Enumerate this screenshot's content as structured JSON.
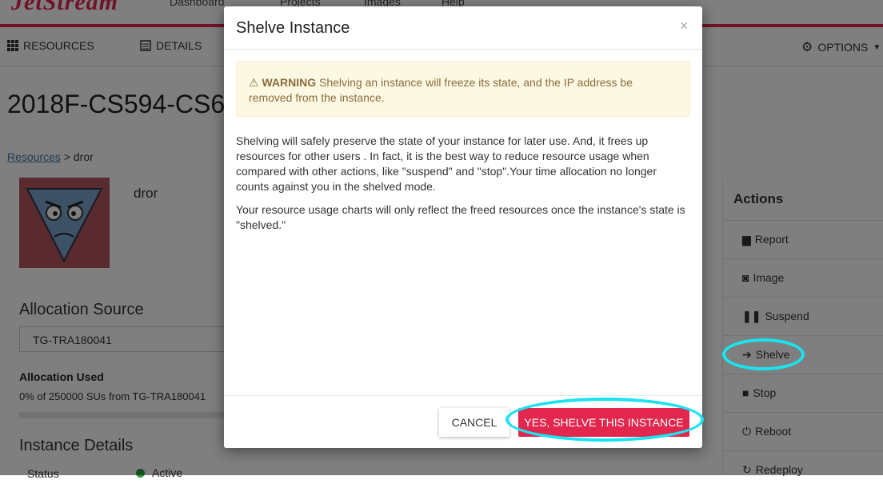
{
  "topnav": {
    "logo": "JetStream",
    "items": [
      "Dashboard",
      "Projects",
      "Images",
      "Help"
    ]
  },
  "subnav": {
    "resources_label": "RESOURCES",
    "details_label": "DETAILS",
    "options_label": "OPTIONS"
  },
  "page": {
    "title": "2018F-CS594-CS6",
    "breadcrumb_link": "Resources",
    "breadcrumb_current": "> dror",
    "instance_name": "dror"
  },
  "allocation": {
    "heading": "Allocation Source",
    "selected": "TG-TRA180041",
    "used_label": "Allocation Used",
    "used_value": "0% of 250000 SUs from TG-TRA180041",
    "used_fraction": 0.0
  },
  "instance_details": {
    "heading": "Instance Details",
    "status_label": "Status",
    "status_value": "Active"
  },
  "actions": {
    "title": "Actions",
    "items": [
      {
        "label": "Report",
        "icon": "inbox-icon"
      },
      {
        "label": "Image",
        "icon": "camera-icon"
      },
      {
        "label": "Suspend",
        "icon": "pause-icon"
      },
      {
        "label": "Shelve",
        "icon": "sign-in-icon"
      },
      {
        "label": "Stop",
        "icon": "stop-icon"
      },
      {
        "label": "Reboot",
        "icon": "power-icon"
      },
      {
        "label": "Redeploy",
        "icon": "refresh-icon"
      }
    ]
  },
  "modal": {
    "title": "Shelve Instance",
    "close": "×",
    "warning_label": "WARNING",
    "warning_text": "Shelving an instance will freeze its state, and the IP address be removed from the instance.",
    "paragraph1": "Shelving will safely preserve the state of your instance for later use. And, it frees up resources for other users . In fact, it is the best way to reduce resource usage when compared with other actions, like \"suspend\" and \"stop\".Your time allocation no longer counts against you in the shelved mode.",
    "paragraph2": "Your resource usage charts will only reflect the freed resources once the instance's state is \"shelved.\"",
    "cancel_label": "CANCEL",
    "confirm_label": "YES, SHELVE THIS INSTANCE"
  },
  "colors": {
    "brand": "#e2264d",
    "highlight": "#19e4f0",
    "warning_bg": "#fcf8e3",
    "warning_text": "#8a6d3b",
    "status_active": "#2e9e3a"
  }
}
